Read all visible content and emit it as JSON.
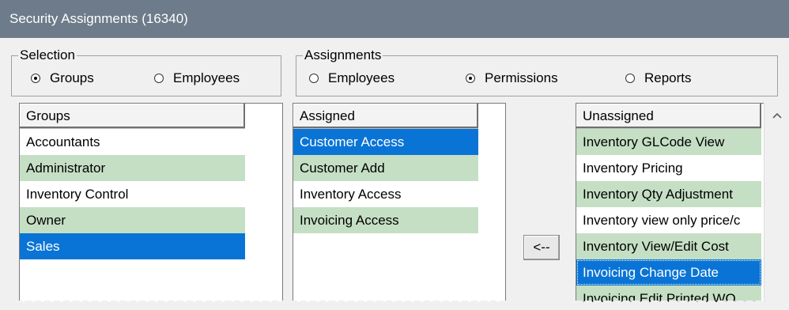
{
  "window": {
    "title": "Security Assignments (16340)"
  },
  "selection": {
    "legend": "Selection",
    "options": [
      {
        "label": "Groups",
        "checked": true
      },
      {
        "label": "Employees",
        "checked": false
      }
    ]
  },
  "assignments": {
    "legend": "Assignments",
    "options": [
      {
        "label": "Employees",
        "checked": false
      },
      {
        "label": "Permissions",
        "checked": true
      },
      {
        "label": "Reports",
        "checked": false
      }
    ]
  },
  "groups_list": {
    "header": "Groups",
    "items": [
      "Accountants",
      "Administrator",
      "Inventory Control",
      "Owner",
      "Sales"
    ],
    "selected": "Sales"
  },
  "assigned_list": {
    "header": "Assigned",
    "items": [
      "Customer Access",
      "Customer Add",
      "Inventory Access",
      "Invoicing Access"
    ],
    "selected": "Customer Access"
  },
  "move_button": {
    "label": "<--"
  },
  "unassigned_list": {
    "header": "Unassigned",
    "items": [
      "Inventory GLCode View",
      "Inventory Pricing",
      "Inventory Qty Adjustment",
      "Inventory view only price/c",
      "Inventory View/Edit Cost",
      "Invoicing Change Date",
      "Invoicing Edit Printed WO"
    ],
    "selected": "Invoicing Change Date"
  },
  "colors": {
    "titlebar": "#6e7b8a",
    "row_alt": "#c5dfc4",
    "selection": "#0a74d6"
  }
}
